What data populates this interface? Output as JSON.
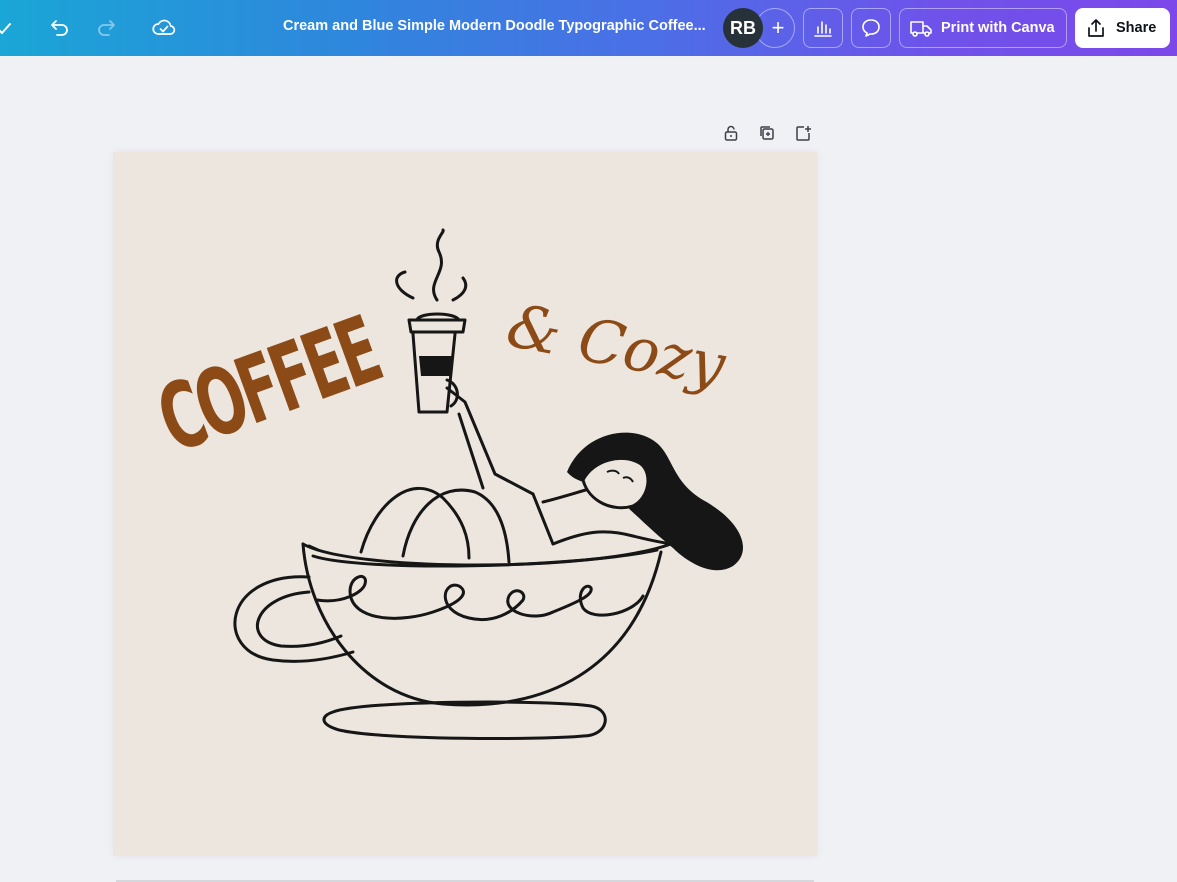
{
  "topbar": {
    "document_title": "Cream and Blue Simple Modern Doodle Typographic Coffee...",
    "avatar_initials": "RB",
    "add_collaborator_symbol": "+",
    "print_label": "Print with Canva",
    "share_label": "Share",
    "icons": {
      "check": "check-icon",
      "undo": "undo-icon",
      "redo": "redo-icon",
      "saved": "cloud-check-icon",
      "analytics": "bar-chart-icon",
      "comments": "comment-icon",
      "print": "truck-icon",
      "share": "upload-icon"
    },
    "colors": {
      "gradient_start": "#1aa6d6",
      "gradient_end": "#7c48ea",
      "avatar_bg": "#263238"
    }
  },
  "page_tools": {
    "icons": [
      "lock-icon",
      "duplicate-page-icon",
      "add-page-icon"
    ]
  },
  "design": {
    "background_color": "#ece6de",
    "text_color": "#8c4a17",
    "headline": "COFFEE",
    "tagline": "& Cozy",
    "illustration": "woman-relaxing-in-coffee-cup-illustration"
  }
}
